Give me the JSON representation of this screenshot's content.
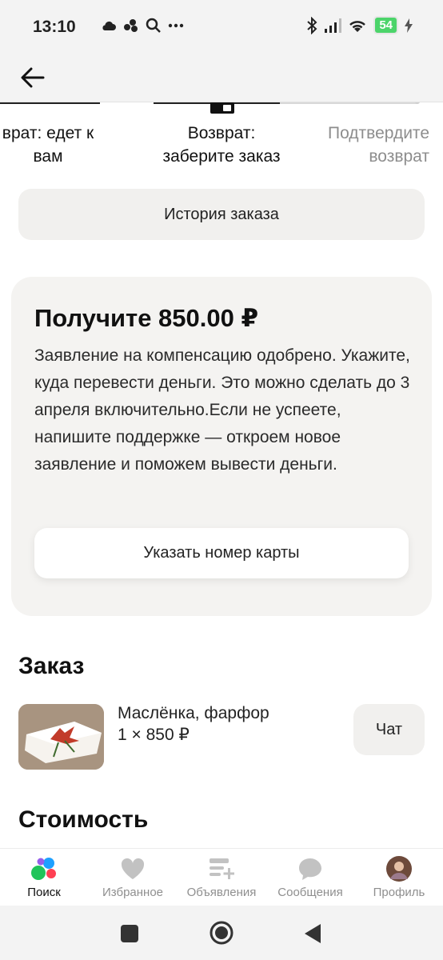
{
  "status_bar": {
    "time": "13:10",
    "battery": "54",
    "icons": [
      "cloud-icon",
      "dots-icon",
      "search-icon",
      "more-icon",
      "bluetooth-icon",
      "signal-icon",
      "wifi-icon",
      "battery-icon",
      "charging-icon"
    ]
  },
  "header": {
    "back_icon": "arrow-left-icon"
  },
  "steps": [
    {
      "label": "Возврат: едет к вам",
      "line1": "врат: едет к",
      "line2": "вам",
      "muted": false
    },
    {
      "label": "Возврат: заберите заказ",
      "line1": "Возврат:",
      "line2": "заберите заказ",
      "muted": false
    },
    {
      "label": "Подтвердите возврат",
      "line1": "Подтвердите",
      "line2": "возврат",
      "muted": true
    }
  ],
  "history_button": "История заказа",
  "refund": {
    "title": "Получите 850.00 ₽",
    "text": "Заявление на компенсацию одобрено. Укажите, куда перевести деньги. Это можно сделать до 3 апреля включительно.Если не успеете, напишите поддержке — откроем новое заявление и поможем вывести деньги.",
    "button": "Указать номер карты"
  },
  "order": {
    "section_title": "Заказ",
    "item_title": "Маслёнка, фарфор",
    "item_qty": "1 × 850 ₽",
    "chat_button": "Чат"
  },
  "cost_section_title": "Стоимость",
  "bottom_nav": [
    {
      "label": "Поиск",
      "icon": "search-dots-icon",
      "active": true
    },
    {
      "label": "Избранное",
      "icon": "heart-icon",
      "active": false
    },
    {
      "label": "Объявления",
      "icon": "ads-list-icon",
      "active": false
    },
    {
      "label": "Сообщения",
      "icon": "chat-bubble-icon",
      "active": false
    },
    {
      "label": "Профиль",
      "icon": "avatar-icon",
      "active": false
    }
  ],
  "colors": {
    "card_bg": "#f4f3f1",
    "button_bg": "#f1f0ee",
    "muted_text": "#8d8d8d"
  }
}
